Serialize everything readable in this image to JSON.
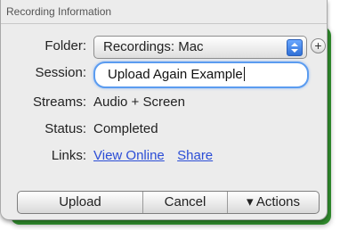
{
  "header": {
    "title": "Recording Information"
  },
  "labels": {
    "folder": "Folder:",
    "session": "Session:",
    "streams": "Streams:",
    "status": "Status:",
    "links": "Links:"
  },
  "folder": {
    "selected": "Recordings: Mac",
    "add_symbol": "+"
  },
  "session": {
    "value": "Upload Again Example"
  },
  "streams": {
    "value": "Audio + Screen"
  },
  "status": {
    "value": "Completed"
  },
  "links": {
    "view_online": "View Online",
    "share": "Share"
  },
  "buttons": {
    "upload": "Upload",
    "cancel": "Cancel",
    "actions": "▾ Actions"
  },
  "colors": {
    "accent_blue": "#5b9cf0",
    "link": "#2b4dd6",
    "backing_green": "#2f8a2c"
  }
}
